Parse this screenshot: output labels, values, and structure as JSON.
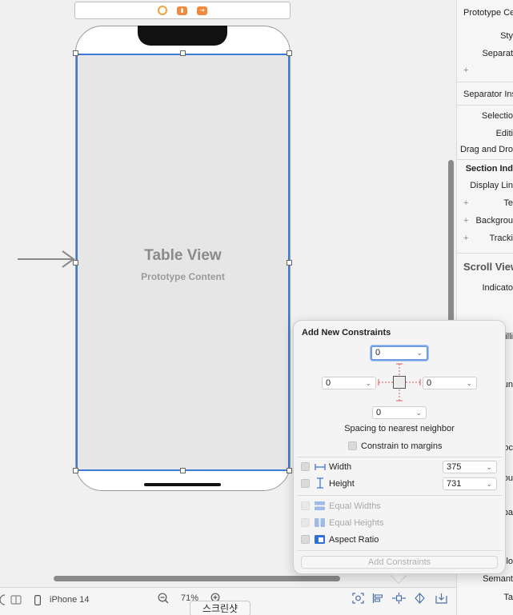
{
  "canvas": {
    "scene_dock_icons": [
      "view-controller-icon",
      "first-responder-icon",
      "exit-icon"
    ],
    "table_view": {
      "title": "Table View",
      "subtitle": "Prototype Content"
    }
  },
  "bottom_bar": {
    "device": "iPhone 14",
    "zoom": "71%",
    "tooltip": "스크린샷"
  },
  "inspector": {
    "rows": [
      {
        "label": "Prototype Ce",
        "bold": false
      },
      {
        "label": "Sty",
        "bold": false
      },
      {
        "label": "Separat",
        "bold": false
      },
      {
        "label": "Separator Ins",
        "bold": false
      },
      {
        "label": "Selectio",
        "bold": false
      },
      {
        "label": "Editi",
        "bold": false
      },
      {
        "label": "Drag and Dro",
        "bold": false
      },
      {
        "label": "Section Ind",
        "bold": true
      },
      {
        "label": "Display Lin",
        "bold": false
      },
      {
        "label": "Te",
        "bold": false
      },
      {
        "label": "Backgrou",
        "bold": false
      },
      {
        "label": "Tracki",
        "bold": false
      },
      {
        "label": "Scroll View",
        "bold": true
      },
      {
        "label": "Indicato",
        "bold": false
      }
    ],
    "partial_rows": [
      "illi",
      "un",
      "oc",
      "ou",
      "pa",
      "lo",
      "Semant",
      "Ta"
    ]
  },
  "popover": {
    "title": "Add New Constraints",
    "spacing": {
      "top": "0",
      "left": "0",
      "right": "0",
      "bottom": "0"
    },
    "spacing_label": "Spacing to nearest neighbor",
    "constrain_to_margins": "Constrain to margins",
    "width_label": "Width",
    "width_value": "375",
    "height_label": "Height",
    "height_value": "731",
    "equal_widths": "Equal Widths",
    "equal_heights": "Equal Heights",
    "aspect_ratio": "Aspect Ratio",
    "add_button": "Add Constraints"
  },
  "colors": {
    "selection_blue": "#3a7bd5",
    "dock_orange": "#f08a3c",
    "focus_ring": "#6e9de6"
  }
}
